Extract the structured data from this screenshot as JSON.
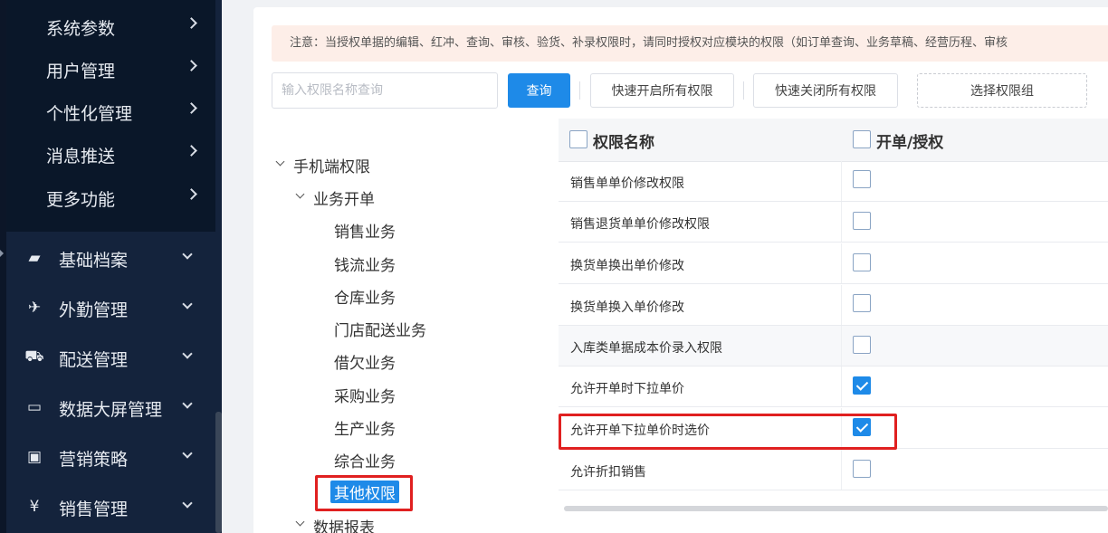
{
  "sidebar": {
    "submenu": [
      {
        "label": "系统参数"
      },
      {
        "label": "用户管理"
      },
      {
        "label": "个性化管理"
      },
      {
        "label": "消息推送"
      },
      {
        "label": "更多功能"
      }
    ],
    "menu": [
      {
        "label": "基础档案",
        "icon": "folder-open-icon",
        "glyph": "▰"
      },
      {
        "label": "外勤管理",
        "icon": "plane-icon",
        "glyph": "✈"
      },
      {
        "label": "配送管理",
        "icon": "truck-icon",
        "glyph": "⛟"
      },
      {
        "label": "数据大屏管理",
        "icon": "monitor-icon",
        "glyph": "▭"
      },
      {
        "label": "营销策略",
        "icon": "share-square-icon",
        "glyph": "▣"
      },
      {
        "label": "销售管理",
        "icon": "yen-icon",
        "glyph": "¥"
      }
    ]
  },
  "notice": {
    "text": "注意：当授权单据的编辑、红冲、查询、审核、验货、补录权限时，请同时授权对应模块的权限（如订单查询、业务草稿、经营历程、审核"
  },
  "toolbar": {
    "search_placeholder": "输入权限名称查询",
    "query_label": "查询",
    "enable_all_label": "快速开启所有权限",
    "disable_all_label": "快速关闭所有权限",
    "select_group_label": "选择权限组"
  },
  "tree": {
    "root": "手机端权限",
    "group": "业务开单",
    "children": [
      "销售业务",
      "钱流业务",
      "仓库业务",
      "门店配送业务",
      "借欠业务",
      "采购业务",
      "生产业务",
      "综合业务"
    ],
    "selected": "其他权限",
    "next_group": "数据报表"
  },
  "table": {
    "headers": {
      "name": "权限名称",
      "grant": "开单/授权"
    },
    "rows": [
      {
        "name": "销售单单价修改权限",
        "checked": false
      },
      {
        "name": "销售退货单单价修改权限",
        "checked": false
      },
      {
        "name": "换货单换出单价修改",
        "checked": false
      },
      {
        "name": "换货单换入单价修改",
        "checked": false
      },
      {
        "name": "入库类单据成本价录入权限",
        "checked": false
      },
      {
        "name": "允许开单时下拉单价",
        "checked": true
      },
      {
        "name": "允许开单下拉单价时选价",
        "checked": true
      },
      {
        "name": "允许折扣销售",
        "checked": false
      }
    ]
  },
  "colors": {
    "sidebar_bg": "#14233c",
    "accent": "#1e8ae8",
    "highlight": "#e02020",
    "notice_bg": "#fdeee8"
  }
}
